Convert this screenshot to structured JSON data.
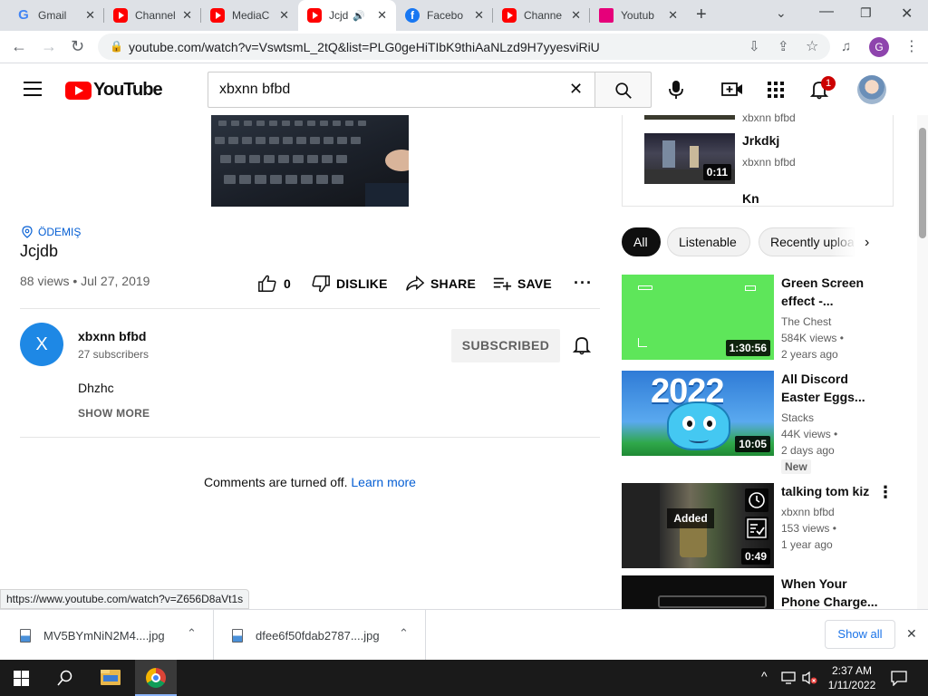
{
  "browser": {
    "tabs": [
      {
        "label": "Gmail",
        "icon": "gmail-icon"
      },
      {
        "label": "Channel",
        "icon": "youtube-icon"
      },
      {
        "label": "MediaC",
        "icon": "youtube-icon"
      },
      {
        "label": "Jcjd",
        "icon": "youtube-icon",
        "active": true
      },
      {
        "label": "Facebo",
        "icon": "facebook-icon"
      },
      {
        "label": "Channe",
        "icon": "youtube-icon"
      },
      {
        "label": "Youtub",
        "icon": "youtube-studio-icon"
      }
    ],
    "url": "youtube.com/watch?v=VswtsmL_2tQ&list=PLG0geHiTIbK9thiAaNLzd9H7yyesviRiU",
    "profile_letter": "G"
  },
  "header": {
    "logo_text": "YouTube",
    "search_value": "xbxnn bfbd",
    "notification_count": "1"
  },
  "video": {
    "location": "ÖDEMIŞ",
    "title": "Jcjdb",
    "meta": "88 views • Jul 27, 2019",
    "like_count": "0",
    "dislike_label": "DISLIKE",
    "share_label": "SHARE",
    "save_label": "SAVE"
  },
  "channel": {
    "avatar_letter": "X",
    "name": "xbxnn bfbd",
    "subscribers": "27 subscribers",
    "subscribe_label": "SUBSCRIBED",
    "description": "Dhzhc",
    "show_more": "SHOW MORE"
  },
  "comments": {
    "text": "Comments are turned off.",
    "link": "Learn more"
  },
  "playlist": {
    "partial_channel": "xbxnn bfbd",
    "item_title": "Jrkdkj",
    "item_channel": "xbxnn bfbd",
    "item_duration": "0:11",
    "next_title": "Kn"
  },
  "chips": [
    "All",
    "Listenable",
    "Recently uploaded"
  ],
  "recommendations": [
    {
      "title": "Green Screen effect -...",
      "channel": "The Chest",
      "views": "584K views •",
      "age": "2 years ago",
      "duration": "1:30:56"
    },
    {
      "title": "All Discord Easter Eggs...",
      "channel": "Stacks",
      "views": "44K views •",
      "age": "2 days ago",
      "badge": "New",
      "duration": "10:05",
      "thumb_text": "2022"
    },
    {
      "title": "talking tom kiz",
      "channel": "xbxnn bfbd",
      "views": "153 views •",
      "age": "1 year ago",
      "duration": "0:49",
      "added": "Added"
    },
    {
      "title": "When Your Phone Charge...",
      "duration": ""
    }
  ],
  "status_url": "https://www.youtube.com/watch?v=Z656D8aVt1s",
  "downloads": [
    {
      "name": "MV5BYmNiN2M4....jpg"
    },
    {
      "name": "dfee6f50fdab2787....jpg"
    }
  ],
  "download_show_all": "Show all",
  "taskbar": {
    "time": "2:37 AM",
    "date": "1/11/2022"
  },
  "colors": {
    "youtube_red": "#ff0000",
    "link_blue": "#065fd4",
    "avatar_blue": "#1e88e5",
    "chip_active": "#0f0f0f",
    "green_screen": "#5ee65a"
  }
}
